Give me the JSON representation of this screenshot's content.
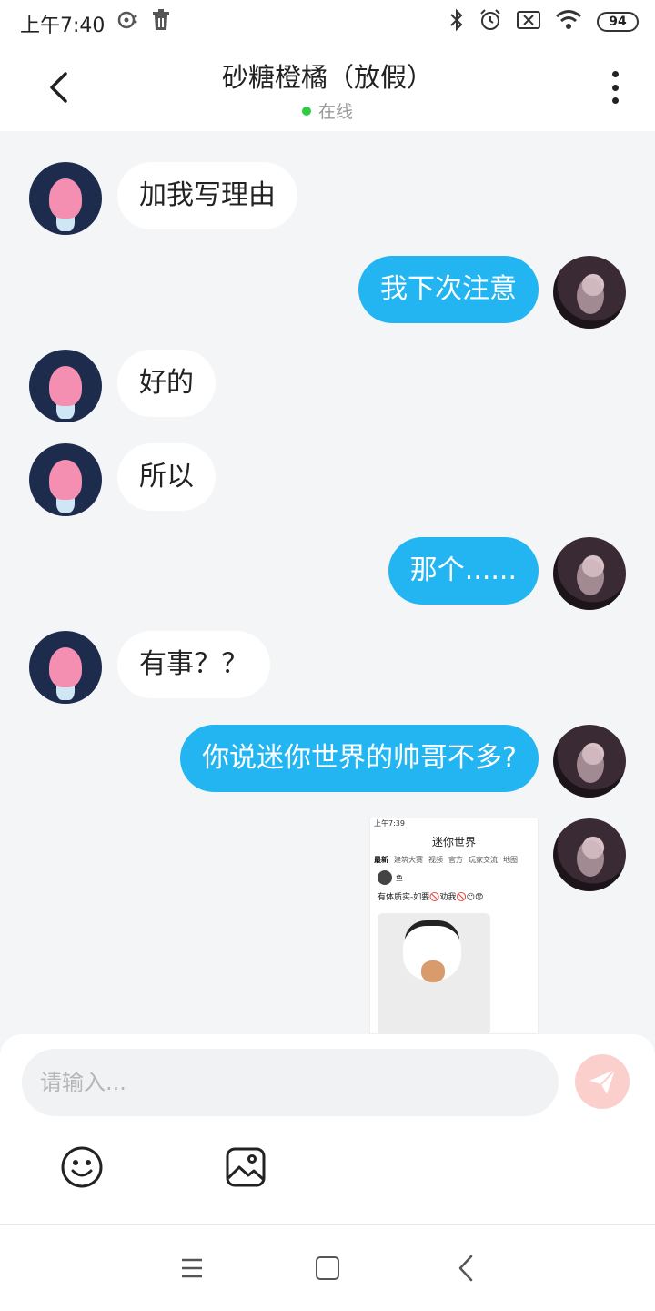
{
  "status_bar": {
    "time": "上午7:40",
    "battery": "94",
    "icons": [
      "media-icon",
      "trash-icon",
      "bluetooth-icon",
      "alarm-icon",
      "sim-icon",
      "wifi-icon",
      "battery-icon"
    ]
  },
  "header": {
    "title": "砂糖橙橘（放假）",
    "status": "在线",
    "status_color": "#2ecc40"
  },
  "messages": [
    {
      "side": "left",
      "text": "加我写理由"
    },
    {
      "side": "right",
      "text": "我下次注意"
    },
    {
      "side": "left",
      "text": "好的"
    },
    {
      "side": "left",
      "text": "所以"
    },
    {
      "side": "right",
      "text": "那个......"
    },
    {
      "side": "left",
      "text": "有事？？"
    },
    {
      "side": "right",
      "text": "你说迷你世界的帅哥不多?"
    }
  ],
  "image_message": {
    "status_time": "上午7:39",
    "title": "迷你世界",
    "tabs": [
      "最新",
      "建筑大赛",
      "视频",
      "官方",
      "玩家交流",
      "地图"
    ],
    "user": "鱼",
    "post_text": "有体质实-如要🚫劝我🚫😶😟"
  },
  "input": {
    "placeholder": "请输入..."
  },
  "colors": {
    "accent": "#23b5f2",
    "send_button": "#fbd0cc",
    "background": "#f4f5f7"
  }
}
